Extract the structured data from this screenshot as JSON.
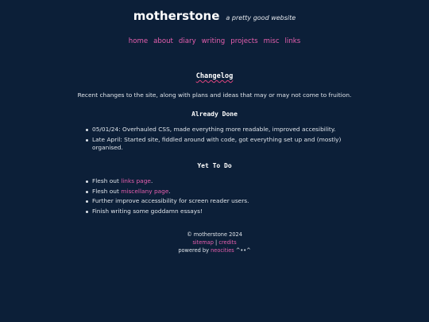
{
  "header": {
    "brand": "motherstone",
    "tagline": "a pretty good website"
  },
  "nav": {
    "items": [
      "home",
      "about",
      "diary",
      "writing",
      "projects",
      "misc",
      "links"
    ]
  },
  "main": {
    "title": "Changelog",
    "intro": "Recent changes to the site, along with plans and ideas that may or may not come to fruition.",
    "done": {
      "heading": "Already Done",
      "items": [
        "05/01/24: Overhauled CSS, made everything more readable, improved accesibility.",
        "Late April: Started site, fiddled around with code, got everything set up and (mostly) organised."
      ]
    },
    "todo": {
      "heading": "Yet To Do",
      "item1_prefix": "Flesh out ",
      "item1_link": "links page",
      "item1_suffix": ".",
      "item2_prefix": "Flesh out ",
      "item2_link": "miscellany page",
      "item2_suffix": ".",
      "item3": "Further improve accessibility for screen reader users.",
      "item4": "Finish writing some goddamn essays!"
    }
  },
  "footer": {
    "copyright": "© motherstone 2024",
    "sitemap": "sitemap",
    "separator": "|",
    "credits": "credits",
    "powered_prefix": "powered by ",
    "neocities": "neocities",
    "emote": " ^••^"
  },
  "colors": {
    "background": "#0c1f38",
    "accent": "#e65fae",
    "text": "#dfe4ea"
  }
}
